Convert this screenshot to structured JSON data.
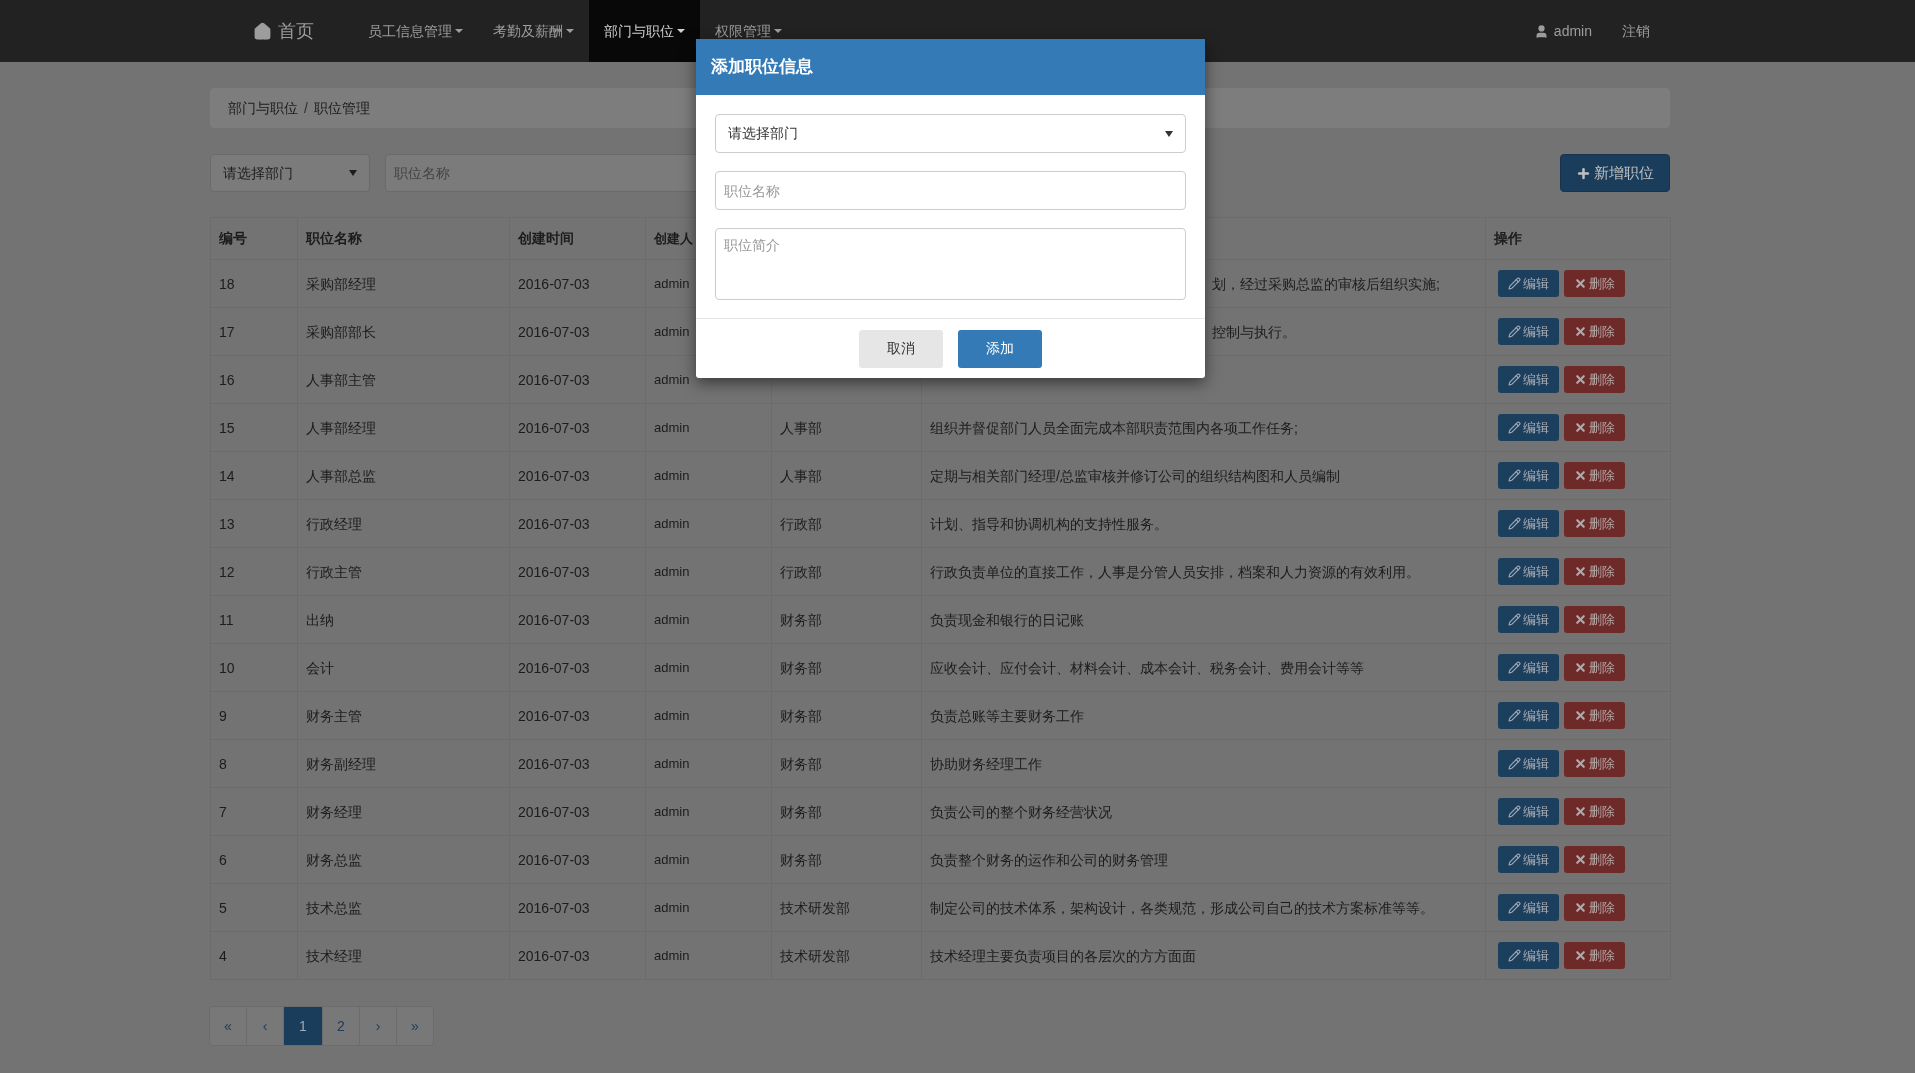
{
  "nav": {
    "items": [
      {
        "label": "首页",
        "kind": "home",
        "selected": false
      },
      {
        "label": "员工信息管理",
        "kind": "dropdown",
        "selected": false
      },
      {
        "label": "考勤及薪酬",
        "kind": "dropdown",
        "selected": false
      },
      {
        "label": "部门与职位",
        "kind": "dropdown",
        "selected": true
      },
      {
        "label": "权限管理",
        "kind": "dropdown",
        "selected": false
      }
    ],
    "user": "admin",
    "logout": "注销"
  },
  "breadcrumb": {
    "items": [
      "部门与职位",
      "职位管理"
    ],
    "separator": "/"
  },
  "filters": {
    "department": "请选择部门",
    "name_placeholder": "职位名称"
  },
  "add_button": "新增职位",
  "table": {
    "header": {
      "id": "编号",
      "name": "职位名称",
      "created": "创建时间",
      "creator": "创建人",
      "actions": "操作"
    },
    "rows": [
      {
        "id": "18",
        "name": "采购部经理",
        "created": "2016-07-03",
        "creator": "admin",
        "description": "划，经过采购总监的审核后组织实施;",
        "edit": "编辑",
        "delete": "删除"
      },
      {
        "id": "17",
        "name": "采购部部长",
        "created": "2016-07-03",
        "creator": "admin",
        "description": "控制与执行。",
        "edit": "编辑",
        "delete": "删除"
      },
      {
        "id": "16",
        "name": "人事部主管",
        "created": "2016-07-03",
        "creator": "admin",
        "edit": "编辑",
        "delete": "删除"
      },
      {
        "id": "15",
        "name": "人事部经理",
        "created": "2016-07-03",
        "creator": "admin",
        "department": "人事部",
        "description": "组织并督促部门人员全面完成本部职责范围内各项工作任务;",
        "edit": "编辑",
        "delete": "删除"
      },
      {
        "id": "14",
        "name": "人事部总监",
        "created": "2016-07-03",
        "creator": "admin",
        "department": "人事部",
        "description": "定期与相关部门经理/总监审核并修订公司的组织结构图和人员编制",
        "edit": "编辑",
        "delete": "删除"
      },
      {
        "id": "13",
        "name": "行政经理",
        "created": "2016-07-03",
        "creator": "admin",
        "department": "行政部",
        "description": "计划、指导和协调机构的支持性服务。",
        "edit": "编辑",
        "delete": "删除"
      },
      {
        "id": "12",
        "name": "行政主管",
        "created": "2016-07-03",
        "creator": "admin",
        "department": "行政部",
        "description": "行政负责单位的直接工作，人事是分管人员安排，档案和人力资源的有效利用。",
        "edit": "编辑",
        "delete": "删除"
      },
      {
        "id": "11",
        "name": "出纳",
        "created": "2016-07-03",
        "creator": "admin",
        "department": "财务部",
        "description": "负责现金和银行的日记账",
        "edit": "编辑",
        "delete": "删除"
      },
      {
        "id": "10",
        "name": "会计",
        "created": "2016-07-03",
        "creator": "admin",
        "department": "财务部",
        "description": "应收会计、应付会计、材料会计、成本会计、税务会计、费用会计等等",
        "edit": "编辑",
        "delete": "删除"
      },
      {
        "id": "9",
        "name": "财务主管",
        "created": "2016-07-03",
        "creator": "admin",
        "department": "财务部",
        "description": "负责总账等主要财务工作",
        "edit": "编辑",
        "delete": "删除"
      },
      {
        "id": "8",
        "name": "财务副经理",
        "created": "2016-07-03",
        "creator": "admin",
        "department": "财务部",
        "description": "协助财务经理工作",
        "edit": "编辑",
        "delete": "删除"
      },
      {
        "id": "7",
        "name": "财务经理",
        "created": "2016-07-03",
        "creator": "admin",
        "department": "财务部",
        "description": "负责公司的整个财务经营状况",
        "edit": "编辑",
        "delete": "删除"
      },
      {
        "id": "6",
        "name": "财务总监",
        "created": "2016-07-03",
        "creator": "admin",
        "department": "财务部",
        "description": "负责整个财务的运作和公司的财务管理",
        "edit": "编辑",
        "delete": "删除"
      },
      {
        "id": "5",
        "name": "技术总监",
        "created": "2016-07-03",
        "creator": "admin",
        "department": "技术研发部",
        "description": "制定公司的技术体系，架构设计，各类规范，形成公司自己的技术方案标准等等。",
        "edit": "编辑",
        "delete": "删除"
      },
      {
        "id": "4",
        "name": "技术经理",
        "created": "2016-07-03",
        "creator": "admin",
        "department": "技术研发部",
        "description": "技术经理主要负责项目的各层次的方方面面",
        "edit": "编辑",
        "delete": "删除"
      }
    ]
  },
  "pagination": [
    {
      "label": "«",
      "selected": false
    },
    {
      "label": "‹",
      "selected": false
    },
    {
      "label": "1",
      "selected": true
    },
    {
      "label": "2",
      "selected": false
    },
    {
      "label": "›",
      "selected": false
    },
    {
      "label": "»",
      "selected": false
    }
  ],
  "modal": {
    "title": "添加职位信息",
    "department": "请选择部门",
    "name_placeholder": "职位名称",
    "description_placeholder": "职位简介",
    "cancel": "取消",
    "submit": "添加"
  }
}
